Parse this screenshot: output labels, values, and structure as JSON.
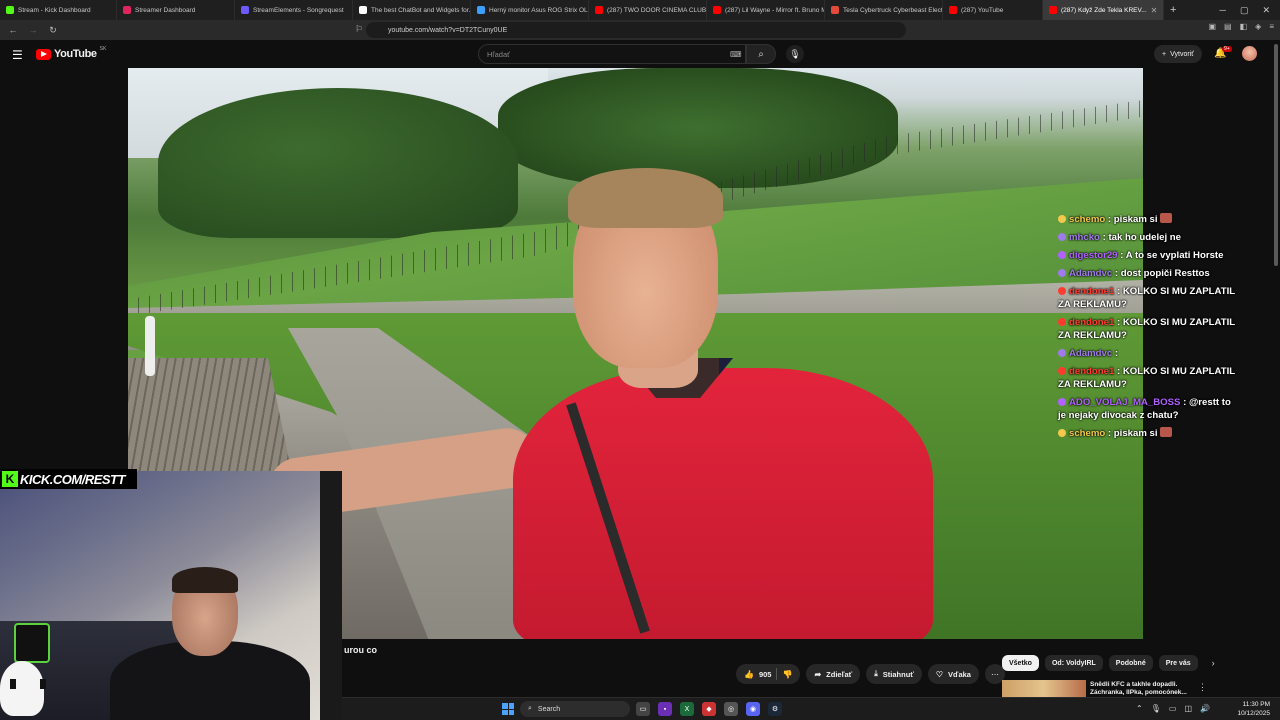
{
  "browser": {
    "tabs": [
      {
        "label": "Stream - Kick Dashboard",
        "color": "#53fc18"
      },
      {
        "label": "Streamer Dashboard",
        "color": "#e0245e"
      },
      {
        "label": "StreamElements - Songrequest",
        "color": "#6b5bff"
      },
      {
        "label": "The best ChatBot and Widgets for...",
        "color": "#ffffff"
      },
      {
        "label": "Herný monitor Asus ROG Strix OLE...",
        "color": "#3aa0ff"
      },
      {
        "label": "(287) TWO DOOR CINEMA CLUB |...",
        "color": "#ff0000"
      },
      {
        "label": "(287) Lil Wayne - Mirror ft. Bruno M...",
        "color": "#ff0000"
      },
      {
        "label": "Tesla Cybertruck Cyberbeast Electr...",
        "color": "#e34a3a"
      },
      {
        "label": "(287) YouTube",
        "color": "#ff0000"
      },
      {
        "label": "(287) Když Zde Tekla KREV...",
        "color": "#ff0000",
        "active": true
      }
    ],
    "url": "youtube.com/watch?v=DT2TCuny0UE"
  },
  "youtube": {
    "logo_text": "YouTube",
    "region": "SK",
    "search_placeholder": "Hľadať",
    "create_label": "Vytvoriť",
    "notif_count": "9+"
  },
  "chat": [
    {
      "user": "schemo",
      "color": "#f2c94c",
      "text": "piskam si",
      "emote": true
    },
    {
      "user": "mhcko",
      "color": "#9f7aea",
      "text": "tak ho udelej ne"
    },
    {
      "user": "digestor29",
      "color": "#b061ff",
      "text": "A to se vyplati Horste"
    },
    {
      "user": "Adamdvc",
      "color": "#9f7aea",
      "text": "dost popiči Resttos"
    },
    {
      "user": "dendone1",
      "color": "#ff3b30",
      "text": "KOLKO SI MU ZAPLATIL ZA REKLAMU?"
    },
    {
      "user": "dendone1",
      "color": "#ff3b30",
      "text": "KOLKO SI MU ZAPLATIL ZA REKLAMU?"
    },
    {
      "user": "Adamdvc",
      "color": "#9f7aea",
      "text": ""
    },
    {
      "user": "dendone1",
      "color": "#ff3b30",
      "text": "KOLKO SI MU ZAPLATIL ZA REKLAMU?"
    },
    {
      "user": "ADO_VOLAJ_MA_BOSS",
      "color": "#b061ff",
      "text": "@restt to je nejaky divocak z chatu?"
    },
    {
      "user": "schemo",
      "color": "#f2c94c",
      "text": "piskam si",
      "emote": true
    }
  ],
  "overlay": {
    "kick_text": "KICK.COM/RESTT"
  },
  "video_meta": {
    "title_fragment": "urou co",
    "like_count": "905",
    "share_label": "Zdieľať",
    "download_label": "Stiahnuť",
    "thanks_label": "Vďaka"
  },
  "chips": [
    "Všetko",
    "Od: VoldyIRL",
    "Podobné",
    "Pre vás"
  ],
  "recommendation": {
    "title": "Snědli KFC a takhle dopadli. Záchranka, IIPka, pomocónek..."
  },
  "taskbar": {
    "search_label": "Search",
    "time": "11:30 PM",
    "date": "10/12/2025"
  }
}
